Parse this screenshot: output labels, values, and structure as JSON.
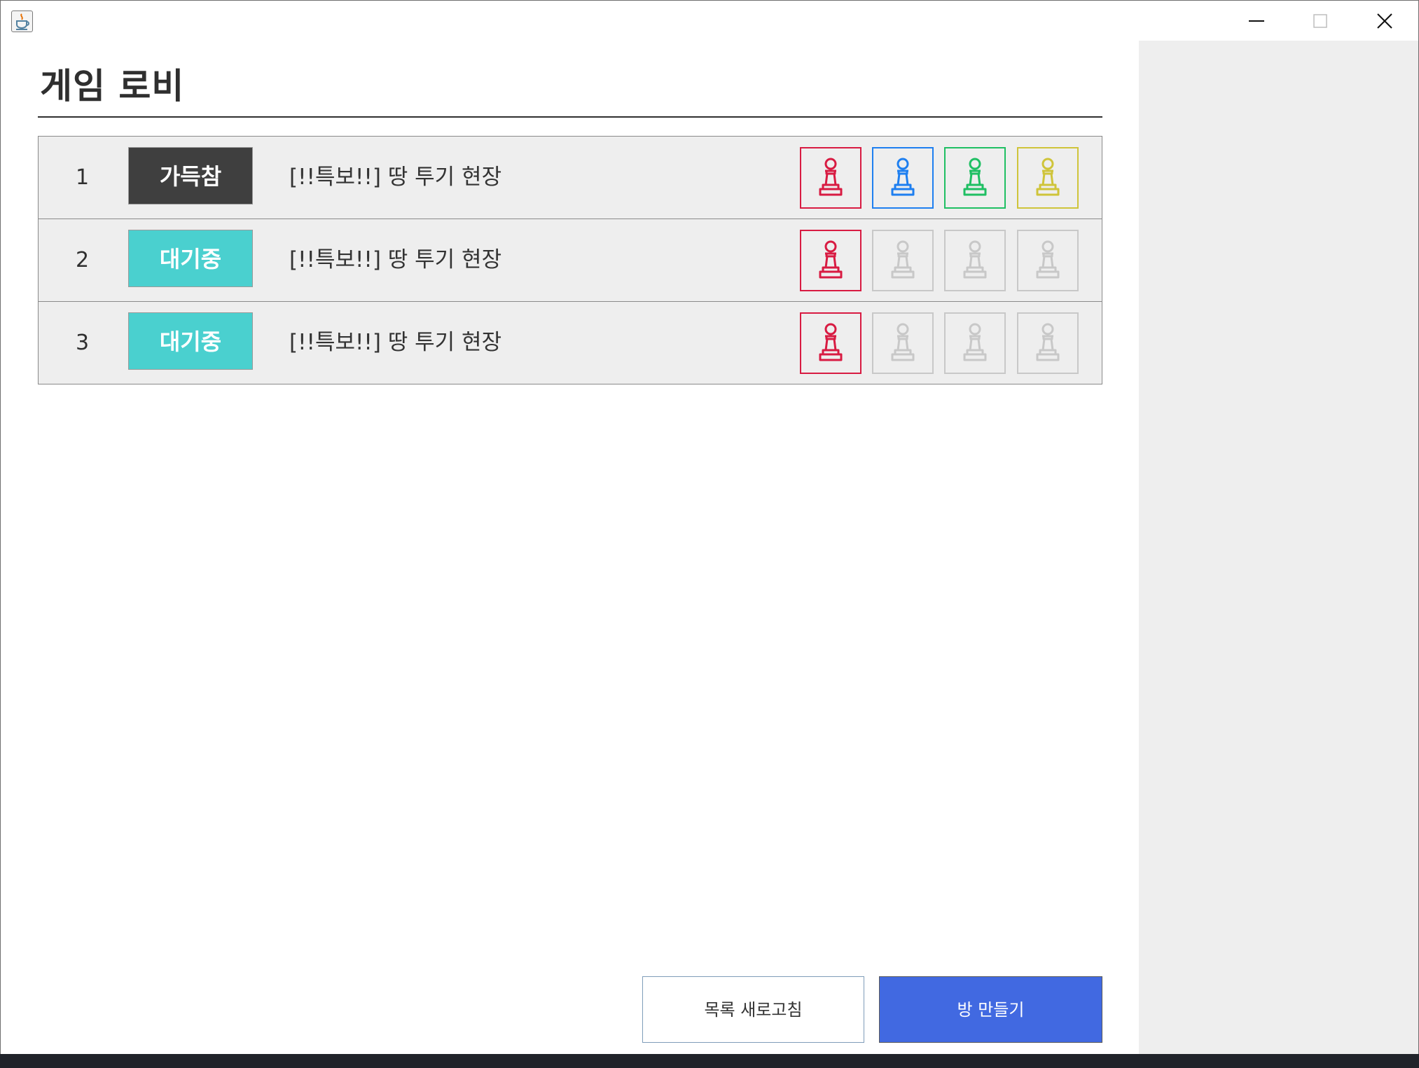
{
  "window": {
    "icon": "java-cup-icon",
    "controls": [
      "minimize-icon",
      "maximize-icon",
      "close-icon"
    ]
  },
  "lobby": {
    "title": "게임 로비"
  },
  "rooms": [
    {
      "number": "1",
      "status": "가득참",
      "status_color": "#3f3f3f",
      "name": "[!!특보!!] 땅 투기 현장",
      "slots": [
        {
          "icon": "pawn-icon",
          "color": "#d81b42",
          "occupied": true
        },
        {
          "icon": "pawn-icon",
          "color": "#1e7ff0",
          "occupied": true
        },
        {
          "icon": "pawn-icon",
          "color": "#1fbf63",
          "occupied": true
        },
        {
          "icon": "pawn-icon",
          "color": "#cfc43a",
          "occupied": true
        }
      ]
    },
    {
      "number": "2",
      "status": "대기중",
      "status_color": "#4ad0cf",
      "name": "[!!특보!!] 땅 투기 현장",
      "slots": [
        {
          "icon": "pawn-icon",
          "color": "#d81b42",
          "occupied": true
        },
        {
          "icon": "pawn-icon",
          "color": "#c8c8c8",
          "occupied": false
        },
        {
          "icon": "pawn-icon",
          "color": "#c8c8c8",
          "occupied": false
        },
        {
          "icon": "pawn-icon",
          "color": "#c8c8c8",
          "occupied": false
        }
      ]
    },
    {
      "number": "3",
      "status": "대기중",
      "status_color": "#4ad0cf",
      "name": "[!!특보!!] 땅 투기 현장",
      "slots": [
        {
          "icon": "pawn-icon",
          "color": "#d81b42",
          "occupied": true
        },
        {
          "icon": "pawn-icon",
          "color": "#c8c8c8",
          "occupied": false
        },
        {
          "icon": "pawn-icon",
          "color": "#c8c8c8",
          "occupied": false
        },
        {
          "icon": "pawn-icon",
          "color": "#c8c8c8",
          "occupied": false
        }
      ]
    }
  ],
  "footer": {
    "refresh_label": "목록 새로고침",
    "create_label": "방 만들기",
    "create_color": "#4169e1"
  }
}
